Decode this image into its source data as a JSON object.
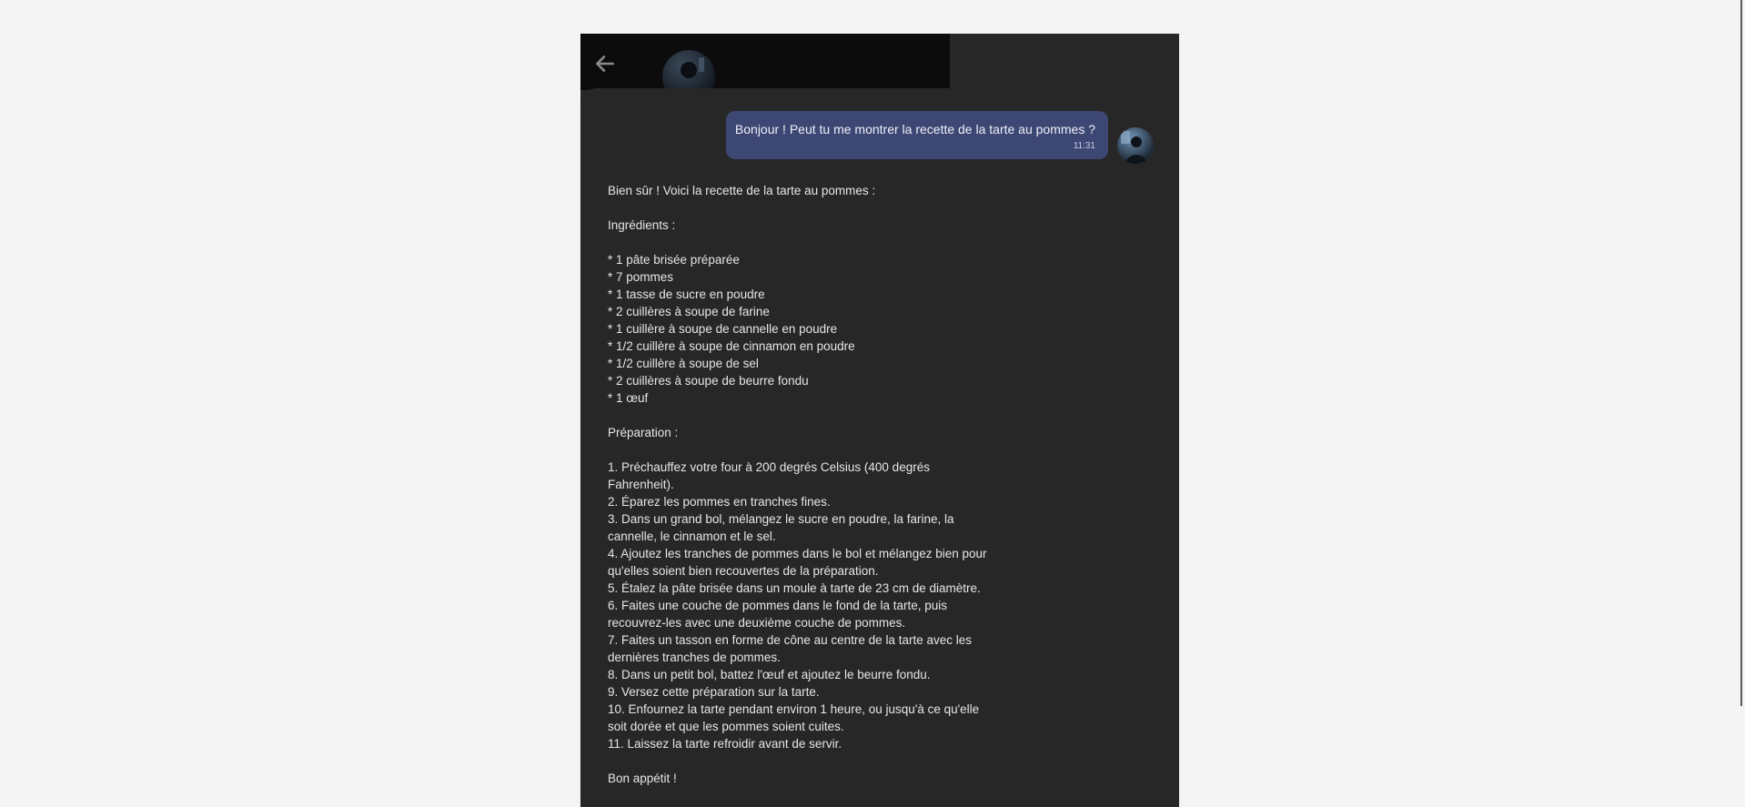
{
  "header": {
    "back_icon": "arrow-left-icon",
    "avatar_icon": "profile-avatar"
  },
  "user_message": {
    "text": "Bonjour ! Peut tu me montrer la recette de la tarte au pommes ?",
    "time": "11:31"
  },
  "bot_message": {
    "intro": "Bien sûr ! Voici la recette de la tarte au pommes :",
    "ingredients_title": "Ingrédients :",
    "ingredients": [
      "* 1 pâte brisée préparée",
      "* 7 pommes",
      "* 1 tasse de sucre en poudre",
      "* 2 cuillères à soupe de farine",
      "* 1 cuillère à soupe de cannelle en poudre",
      "* 1/2 cuillère à soupe de cinnamon en poudre",
      "* 1/2 cuillère à soupe de sel",
      "* 2 cuillères à soupe de beurre fondu",
      "* 1 œuf"
    ],
    "preparation_title": "Préparation :",
    "steps": [
      "1. Préchauffez votre four à 200 degrés Celsius (400 degrés Fahrenheit).",
      "2. Éparez les pommes en tranches fines.",
      "3. Dans un grand bol, mélangez le sucre en poudre, la farine, la cannelle, le cinnamon et le sel.",
      "4. Ajoutez les tranches de pommes dans le bol et mélangez bien pour qu'elles soient bien recouvertes de la préparation.",
      "5. Étalez la pâte brisée dans un moule à tarte de 23 cm de diamètre.",
      "6. Faites une couche de pommes dans le fond de la tarte, puis recouvrez-les avec une deuxième couche de pommes.",
      "7. Faites un tasson en forme de cône au centre de la tarte avec les dernières tranches de pommes.",
      "8. Dans un petit bol, battez l'œuf et ajoutez le beurre fondu.",
      "9. Versez cette préparation sur la tarte.",
      "10. Enfournez la tarte pendant environ 1 heure, ou jusqu'à ce qu'elle soit dorée et que les pommes soient cuites.",
      "11. Laissez la tarte refroidir avant de servir."
    ],
    "closing": "Bon appétit !"
  }
}
